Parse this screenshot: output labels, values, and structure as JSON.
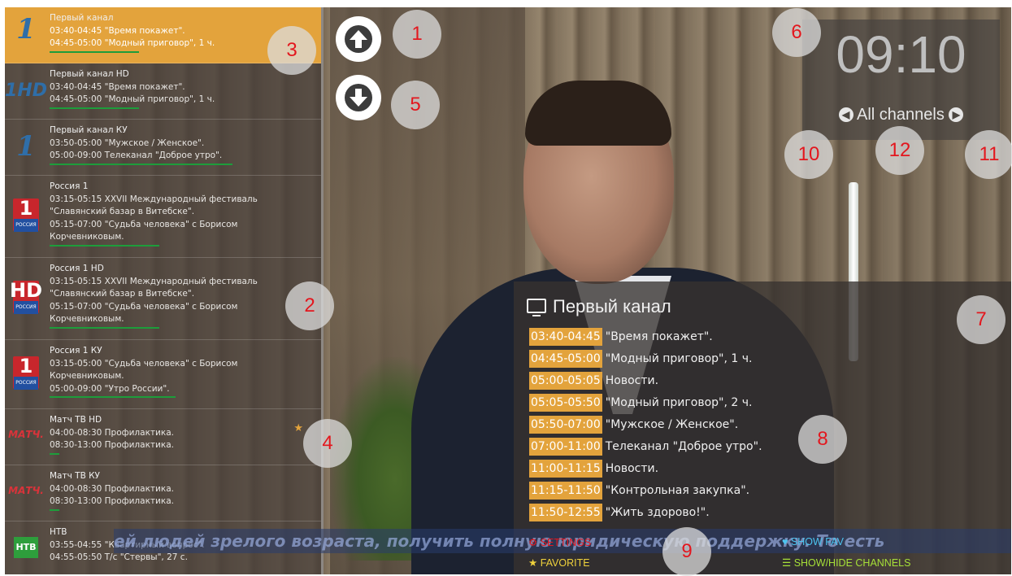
{
  "channels": [
    {
      "name": "Первый канал",
      "line1": "03:40-04:45 \"Время покажет\".",
      "line2": "04:45-05:00 \"Модный приговор\", 1 ч.",
      "logo": "channel-one-logo",
      "selected": true
    },
    {
      "name": "Первый канал HD",
      "line1": "03:40-04:45 \"Время покажет\".",
      "line2": "04:45-05:00 \"Модный приговор\", 1 ч.",
      "logo": "channel-one-hd-logo"
    },
    {
      "name": "Первый канал КУ",
      "line1": "03:50-05:00 \"Мужское / Женское\".",
      "line2": "05:00-09:00 Телеканал \"Доброе утро\".",
      "logo": "channel-one-logo"
    },
    {
      "name": "Россия 1",
      "line1": "03:15-05:15 XXVII Международный фестиваль",
      "line2": "\"Славянский базар в Витебске\".",
      "line3": "05:15-07:00 \"Судьба человека\" с Борисом",
      "line4": "Корчевниковым.",
      "logo": "russia-1-logo"
    },
    {
      "name": "Россия 1 HD",
      "line1": "03:15-05:15 XXVII Международный фестиваль",
      "line2": "\"Славянский базар в Витебске\".",
      "line3": "05:15-07:00 \"Судьба человека\" с Борисом",
      "line4": "Корчевниковым.",
      "logo": "russia-1-hd-logo"
    },
    {
      "name": "Россия 1 КУ",
      "line1": "03:15-05:00 \"Судьба человека\" с Борисом",
      "line2": "Корчевниковым.",
      "line3": "05:00-09:00 \"Утро России\".",
      "logo": "russia-1-logo"
    },
    {
      "name": "Матч ТВ HD",
      "line1": "04:00-08:30 Профилактика.",
      "line2": "08:30-13:00 Профилактика.",
      "logo": "match-tv-logo",
      "favorite": true
    },
    {
      "name": "Матч ТВ КУ",
      "line1": "04:00-08:30 Профилактика.",
      "line2": "08:30-13:00 Профилактика.",
      "logo": "match-tv-logo"
    },
    {
      "name": "НТВ",
      "line1": "03:55-04:55 \"Квартирный вопрос\".",
      "line2": "04:55-05:50 Т/с \"Стервы\", 27 с.",
      "logo": "ntv-logo"
    }
  ],
  "logos": {
    "one": "1",
    "onehd": "1HD",
    "russia_big": "1",
    "russia_small": "РОССИЯ",
    "russia_hd_big": "HD",
    "match": "МАТЧ.",
    "ntv": "НТВ"
  },
  "markers": [
    "1",
    "2",
    "3",
    "4",
    "5",
    "6",
    "7",
    "8",
    "9",
    "10",
    "11",
    "12"
  ],
  "clock": {
    "time": "09:10",
    "group": "All channels"
  },
  "epg": {
    "title": "Первый канал",
    "rows": [
      {
        "time": "03:40-04:45",
        "title": "\"Время покажет\"."
      },
      {
        "time": "04:45-05:00",
        "title": "\"Модный приговор\", 1 ч."
      },
      {
        "time": "05:00-05:05",
        "title": "Новости."
      },
      {
        "time": "05:05-05:50",
        "title": "\"Модный приговор\", 2 ч."
      },
      {
        "time": "05:50-07:00",
        "title": "\"Мужское / Женское\"."
      },
      {
        "time": "07:00-11:00",
        "title": "Телеканал \"Доброе утро\"."
      },
      {
        "time": "11:00-11:15",
        "title": "Новости."
      },
      {
        "time": "11:15-11:50",
        "title": "\"Контрольная закупка\"."
      },
      {
        "time": "11:50-12:55",
        "title": "\"Жить здорово!\"."
      }
    ]
  },
  "ticker": "ей людей зрелого возраста, получить полную юридическую поддержку.   То есть",
  "buttons": {
    "settings": "SETTINGS",
    "favorite": "FAVORITE",
    "show_fav": "SHOW FAV",
    "show_hide": "SHOW/HIDE CHANNELS"
  },
  "colors": {
    "accent": "#e3a33c",
    "marker_text": "#e3171e",
    "settings": "#e3171e",
    "favorite": "#f0d23c",
    "show_fav": "#4cc4f0",
    "show_hide": "#a6e038",
    "progress": "#1d9d3b"
  }
}
